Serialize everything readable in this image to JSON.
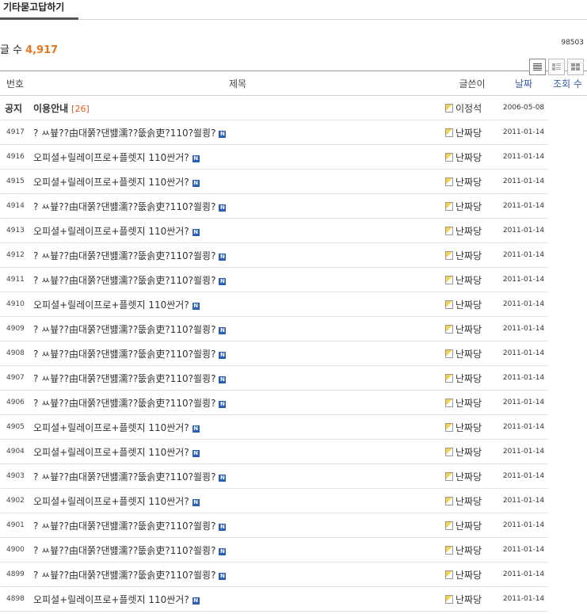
{
  "board": {
    "tab_label": "기타묻고답하기",
    "count_label": "글 수",
    "count_value": "4,917"
  },
  "columns": {
    "no": "번호",
    "title": "제목",
    "author": "글쓴이",
    "date": "날짜",
    "views": "조회 수"
  },
  "notice": {
    "no": "공지",
    "title": "이용안내",
    "comments": "[26]",
    "author": "이정석",
    "date": "2006-05-08",
    "views": "98503"
  },
  "rows": [
    {
      "no": "4917",
      "title": "? ㅆ븊??由대쭑?댄뱶濡??뚮솕吏?110?쐴쾽?",
      "author": "난짜당",
      "date": "2011-01-14",
      "new": "N"
    },
    {
      "no": "4916",
      "title": "오피셜+릴레이프로+플렛지 110싼거?",
      "author": "난짜당",
      "date": "2011-01-14",
      "new": "N"
    },
    {
      "no": "4915",
      "title": "오피셜+릴레이프로+플렛지 110싼거?",
      "author": "난짜당",
      "date": "2011-01-14",
      "new": "N"
    },
    {
      "no": "4914",
      "title": "? ㅆ븊??由대쭑?댄뱶濡??뚮솕吏?110?쐴쾽?",
      "author": "난짜당",
      "date": "2011-01-14",
      "new": "N"
    },
    {
      "no": "4913",
      "title": "오피셜+릴레이프로+플렛지 110싼거?",
      "author": "난짜당",
      "date": "2011-01-14",
      "new": "N"
    },
    {
      "no": "4912",
      "title": "? ㅆ븊??由대쭑?댄뱶濡??뚮솕吏?110?쐴쾽?",
      "author": "난짜당",
      "date": "2011-01-14",
      "new": "N"
    },
    {
      "no": "4911",
      "title": "? ㅆ븊??由대쭑?댄뱶濡??뚮솕吏?110?쐴쾽?",
      "author": "난짜당",
      "date": "2011-01-14",
      "new": "N"
    },
    {
      "no": "4910",
      "title": "오피셜+릴레이프로+플렛지 110싼거?",
      "author": "난짜당",
      "date": "2011-01-14",
      "new": "N"
    },
    {
      "no": "4909",
      "title": "? ㅆ븊??由대쭑?댄뱶濡??뚮솕吏?110?쐴쾽?",
      "author": "난짜당",
      "date": "2011-01-14",
      "new": "N"
    },
    {
      "no": "4908",
      "title": "? ㅆ븊??由대쭑?댄뱶濡??뚮솕吏?110?쐴쾽?",
      "author": "난짜당",
      "date": "2011-01-14",
      "new": "N"
    },
    {
      "no": "4907",
      "title": "? ㅆ븊??由대쭑?댄뱶濡??뚮솕吏?110?쐴쾽?",
      "author": "난짜당",
      "date": "2011-01-14",
      "new": "N"
    },
    {
      "no": "4906",
      "title": "? ㅆ븊??由대쭑?댄뱶濡??뚮솕吏?110?쐴쾽?",
      "author": "난짜당",
      "date": "2011-01-14",
      "new": "N"
    },
    {
      "no": "4905",
      "title": "오피셜+릴레이프로+플렛지 110싼거?",
      "author": "난짜당",
      "date": "2011-01-14",
      "new": "N"
    },
    {
      "no": "4904",
      "title": "오피셜+릴레이프로+플렛지 110싼거?",
      "author": "난짜당",
      "date": "2011-01-14",
      "new": "N"
    },
    {
      "no": "4903",
      "title": "? ㅆ븊??由대쭑?댄뱶濡??뚮솕吏?110?쐴쾽?",
      "author": "난짜당",
      "date": "2011-01-14",
      "new": "N"
    },
    {
      "no": "4902",
      "title": "오피셜+릴레이프로+플렛지 110싼거?",
      "author": "난짜당",
      "date": "2011-01-14",
      "new": "N"
    },
    {
      "no": "4901",
      "title": "? ㅆ븊??由대쭑?댄뱶濡??뚮솕吏?110?쐴쾽?",
      "author": "난짜당",
      "date": "2011-01-14",
      "new": "N"
    },
    {
      "no": "4900",
      "title": "? ㅆ븊??由대쭑?댄뱶濡??뚮솕吏?110?쐴쾽?",
      "author": "난짜당",
      "date": "2011-01-14",
      "new": "N"
    },
    {
      "no": "4899",
      "title": "? ㅆ븊??由대쭑?댄뱶濡??뚮솕吏?110?쐴쾽?",
      "author": "난짜당",
      "date": "2011-01-14",
      "new": "N"
    },
    {
      "no": "4898",
      "title": "오피셜+릴레이프로+플렛지 110싼거?",
      "author": "난짜당",
      "date": "2011-01-14",
      "new": "N"
    }
  ],
  "icons": {
    "view_list": "list-view-icon",
    "view_webzine": "webzine-view-icon",
    "view_gallery": "gallery-view-icon",
    "user": "member-icon"
  }
}
